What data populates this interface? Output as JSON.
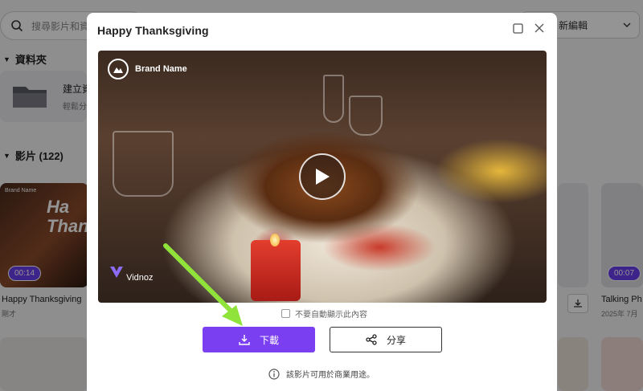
{
  "background": {
    "search_placeholder": "搜尋影片和資",
    "sort_label": "新編輯",
    "folders_section": "資料夾",
    "folder_card_title": "建立資",
    "folder_card_sub": "輕鬆分",
    "videos_section": "影片 (122)",
    "videos": [
      {
        "title": "Happy Thanksgiving",
        "sub": "剛才",
        "duration": "00:14",
        "thumb_text": "Ha Than",
        "thumb_brand": "Brand Name"
      },
      {
        "title": "Talking Ph",
        "sub": "2025年 7月",
        "duration": "00:07"
      }
    ]
  },
  "modal": {
    "title": "Happy Thanksgiving",
    "video": {
      "brand_name": "Brand Name",
      "watermark": "Vidnoz"
    },
    "dont_show_label": "不要自動顯示此內容",
    "download_label": "下載",
    "share_label": "分享",
    "commercial_note": "該影片可用於商業用途。"
  },
  "colors": {
    "accent": "#7b3ff2",
    "arrow": "#8fe33a"
  }
}
